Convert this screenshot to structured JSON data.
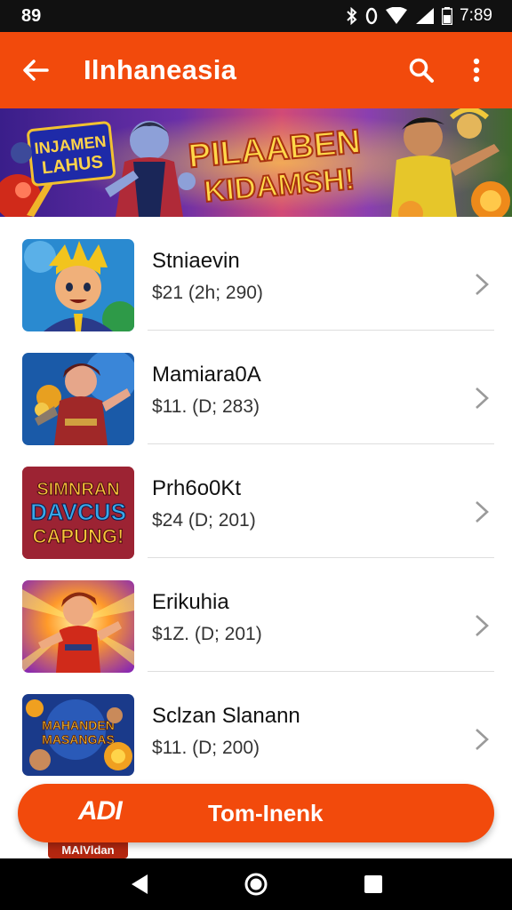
{
  "status_bar": {
    "left_text": "89",
    "time": "7:89",
    "icons": [
      "bluetooth-icon",
      "vibrate-icon",
      "wifi-icon",
      "signal-icon",
      "battery-icon"
    ]
  },
  "app_bar": {
    "title": "Ilnhaneasia",
    "back_icon": "arrow-back-icon",
    "search_icon": "search-icon",
    "more_icon": "more-vert-icon",
    "color": "#f24a0c"
  },
  "banner": {
    "left_text_line1": "INJAMEN",
    "left_text_line2": "LAHUS",
    "headline_line1": "PILAABEN",
    "headline_line2": "KIDAMSH!"
  },
  "list": {
    "items": [
      {
        "name": "Stniaevin",
        "price": "$21 (2h; 290)",
        "thumb": "hero-yellow-hair"
      },
      {
        "name": "Mamiara0A",
        "price": "$11. (D; 283)",
        "thumb": "warrior-red-armor"
      },
      {
        "name": "Prh6o0Kt",
        "price": "$24 (D; 201)",
        "thumb": "title-art"
      },
      {
        "name": "Erikuhia",
        "price": "$1Z. (D; 201)",
        "thumb": "hero-burst"
      },
      {
        "name": "Sclzan Slanann",
        "price": "$11. (D; 200)",
        "thumb": "treasure-art"
      }
    ],
    "thumb3_text_line1": "SIMNRAN",
    "thumb3_text_line2": "DAVCUS",
    "thumb3_text_line3": "CAPUNG!",
    "thumb5_text_line1": "MAHANDEN",
    "thumb5_text_line2": "MASANGAS"
  },
  "cta": {
    "logo_text": "ADI",
    "label": "Tom-Inenk"
  },
  "behind_tag": "MAlVldan",
  "nav_bar": {
    "icons": [
      "back-triangle-icon",
      "home-circle-icon",
      "recents-square-icon"
    ]
  }
}
